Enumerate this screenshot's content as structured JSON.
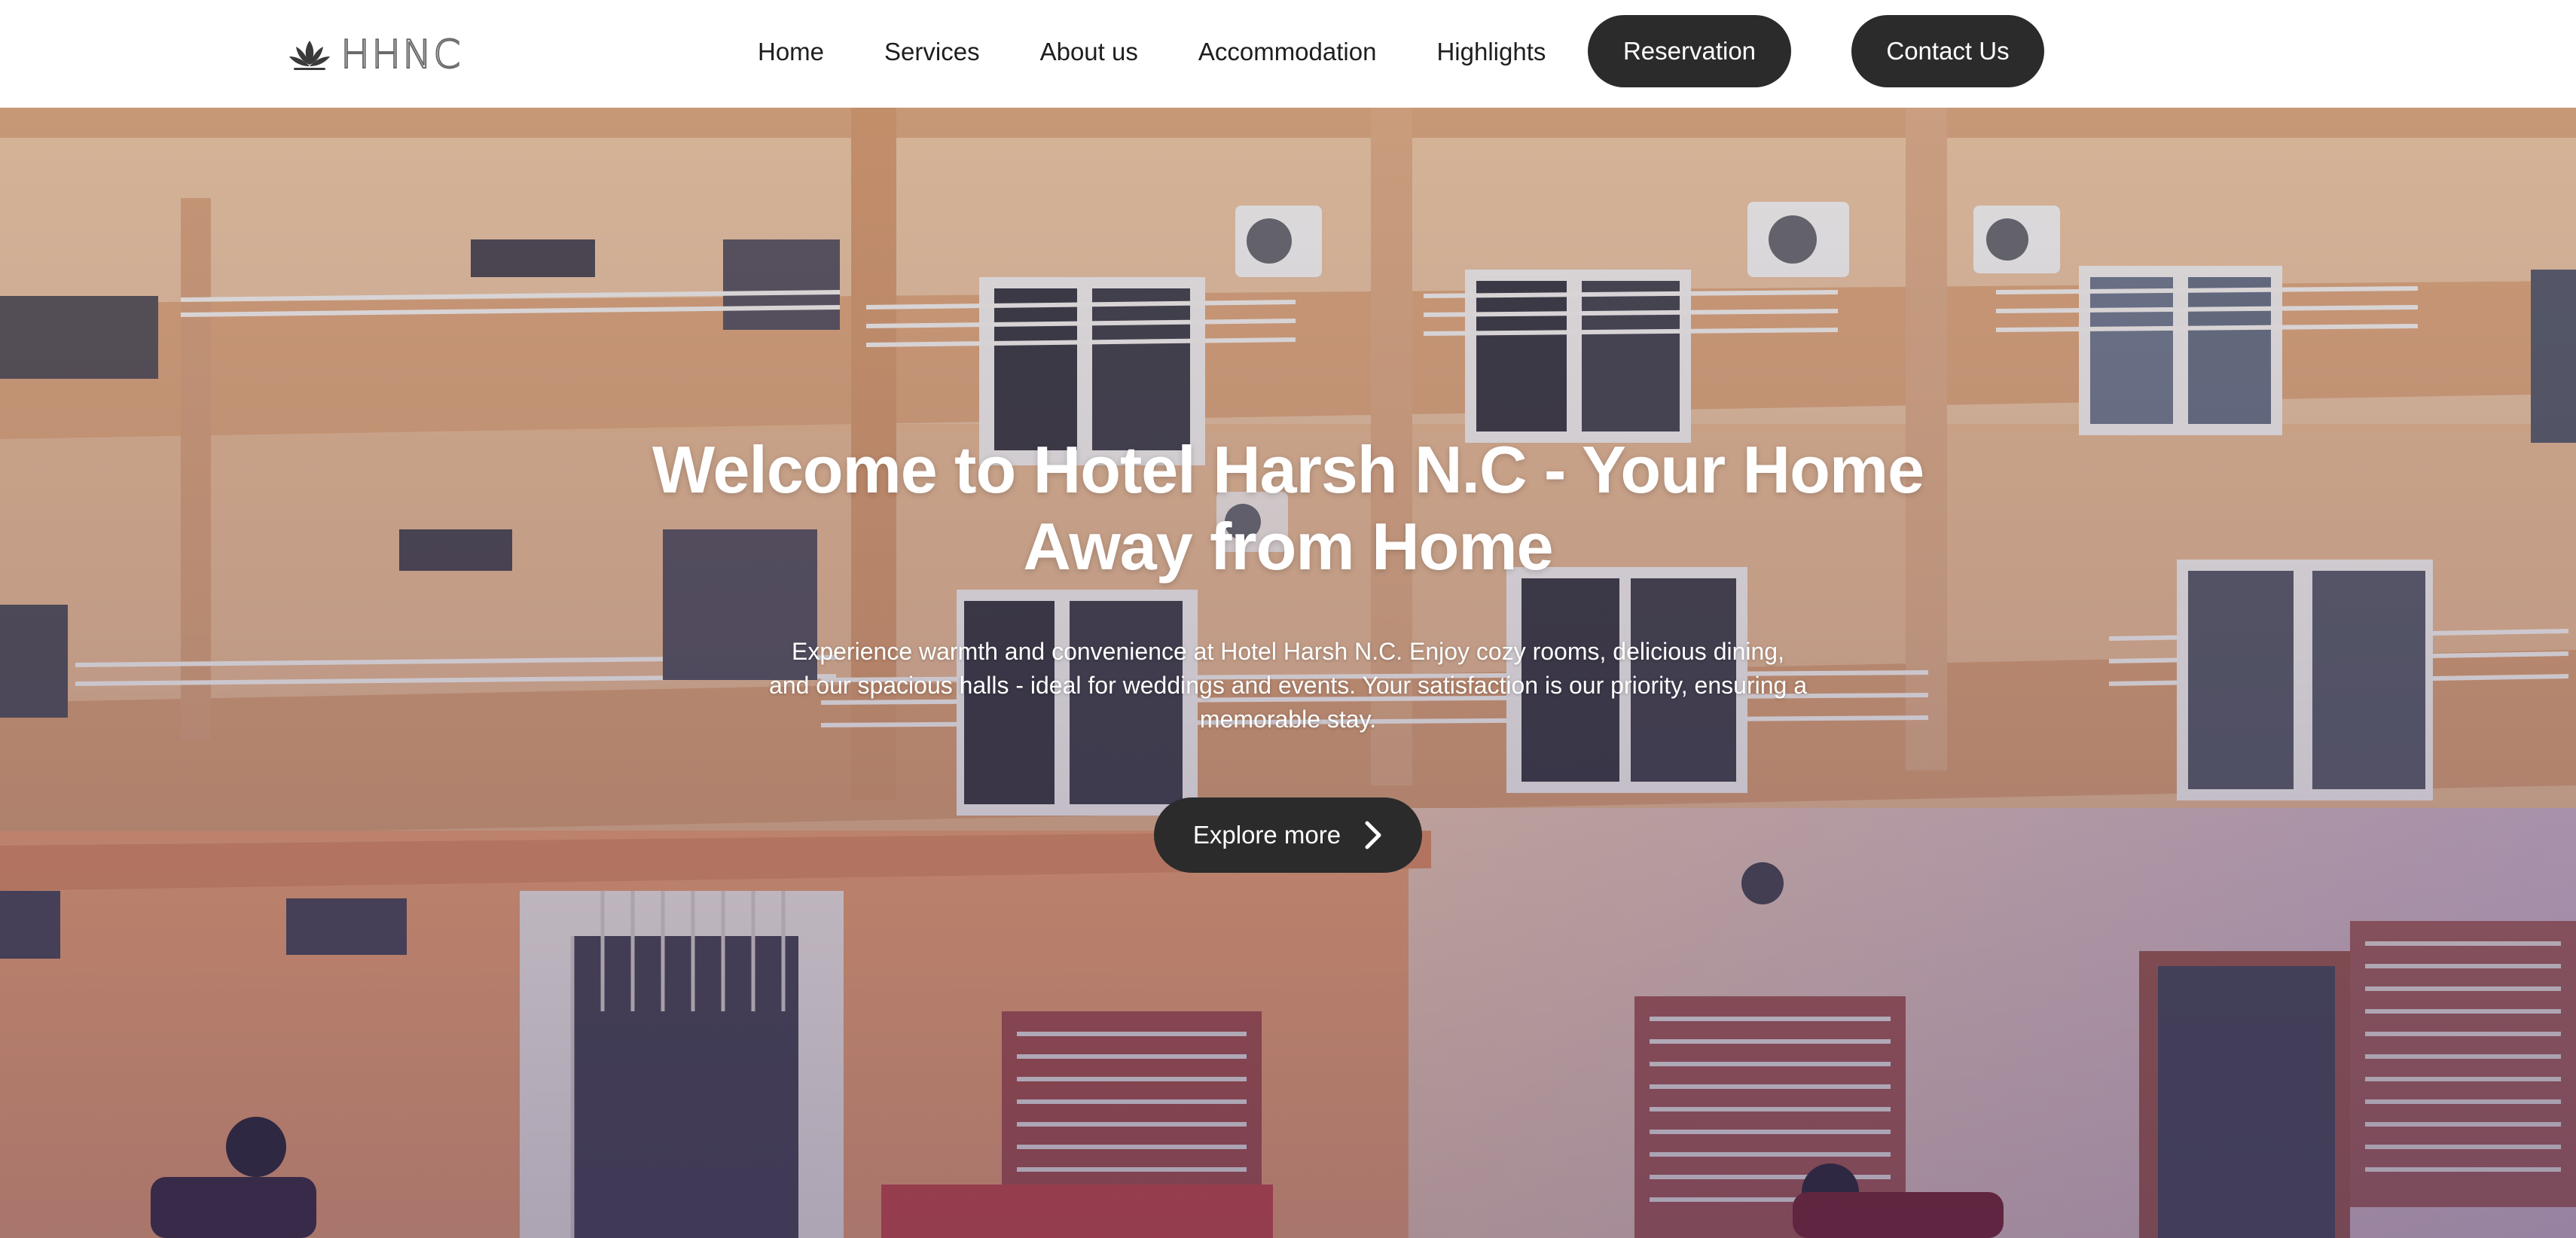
{
  "logo": {
    "text": "HHNC",
    "icon": "lotus-icon"
  },
  "nav": {
    "items": [
      {
        "label": "Home"
      },
      {
        "label": "Services"
      },
      {
        "label": "About us"
      },
      {
        "label": "Accommodation"
      },
      {
        "label": "Highlights"
      }
    ],
    "reservation_label": "Reservation",
    "contact_label": "Contact Us"
  },
  "hero": {
    "title": "Welcome to Hotel Harsh N.C - Your Home Away from Home",
    "subtitle": "Experience warmth and convenience at Hotel Harsh N.C. Enjoy cozy rooms, delicious dining, and our spacious halls - ideal for weddings and events. Your satisfaction is our priority, ensuring a memorable stay.",
    "cta_label": "Explore more",
    "cta_icon": "chevron-right-icon",
    "background": "hotel-building-photo"
  },
  "colors": {
    "button_bg": "#2b2b2b",
    "header_bg": "#ffffff",
    "nav_text": "#1e1e1e",
    "hero_text": "#ffffff"
  }
}
